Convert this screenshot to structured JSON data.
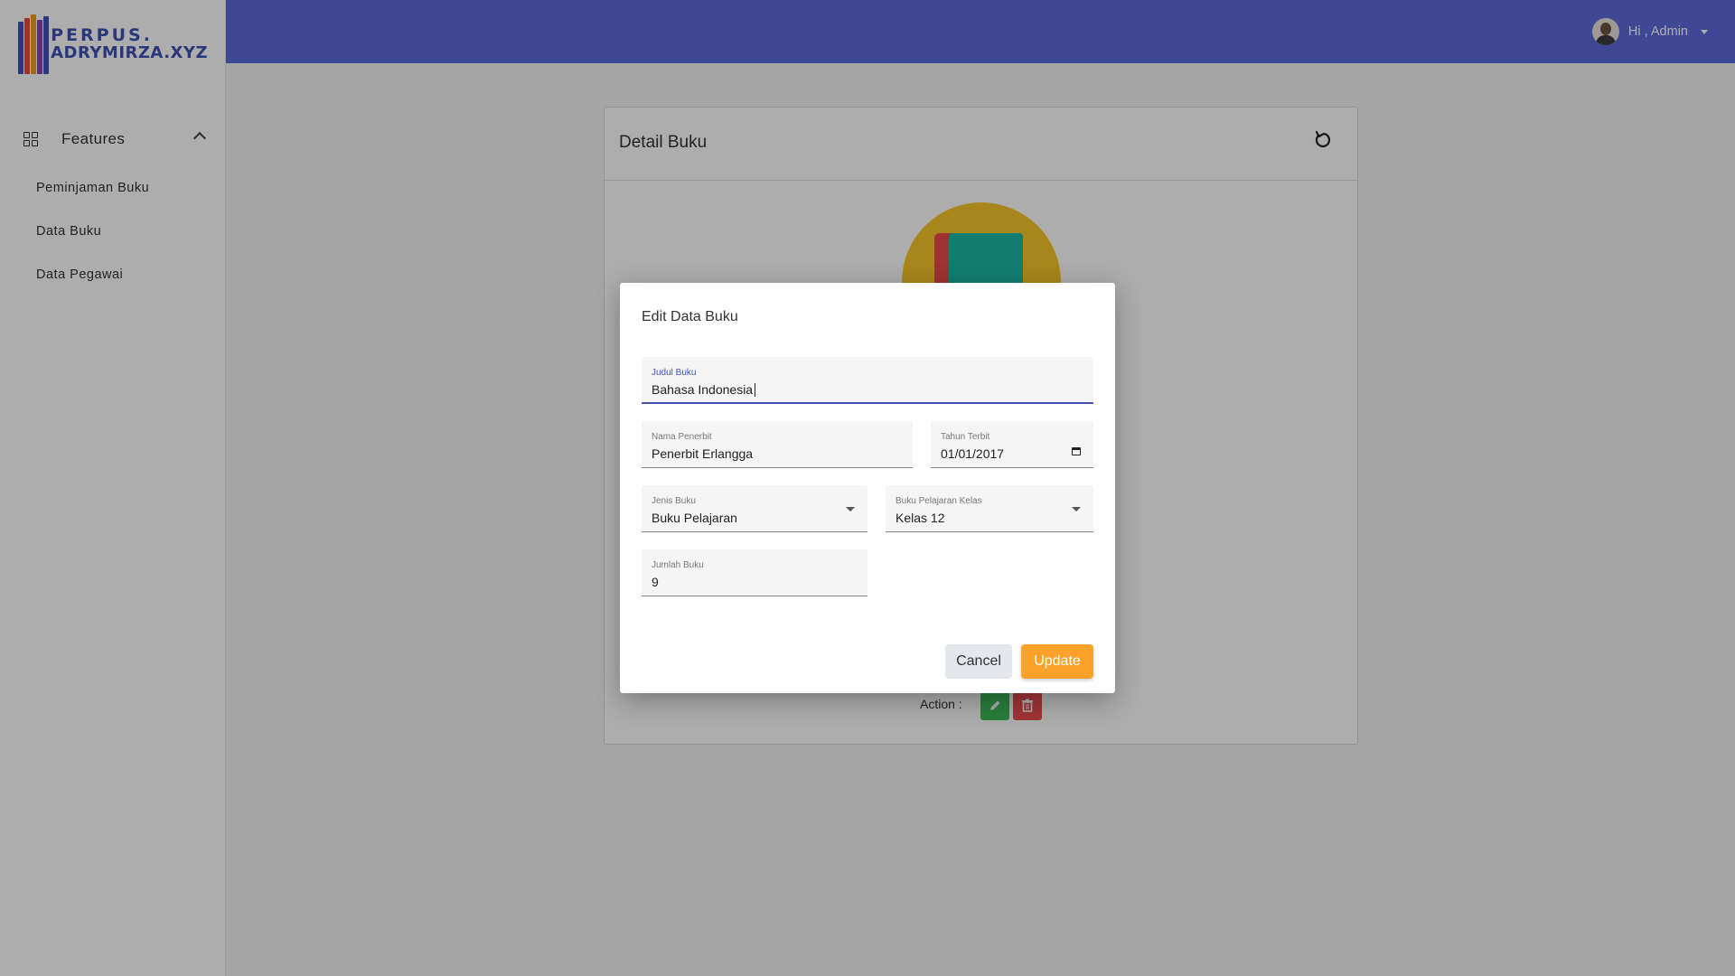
{
  "brand": {
    "line1": "PERPUS.",
    "line2": "ADRYMIRZA.XYZ"
  },
  "sidebar": {
    "section": {
      "label": "Features",
      "icon": "grid-icon",
      "expanded": true
    },
    "items": [
      {
        "label": "Peminjaman Buku"
      },
      {
        "label": "Data Buku"
      },
      {
        "label": "Data Pegawai"
      }
    ]
  },
  "header": {
    "greeting": "Hi , Admin",
    "accent_color": "#5c6bdc"
  },
  "detail_card": {
    "title": "Detail Buku",
    "action_label": "Action :"
  },
  "modal": {
    "title": "Edit Data Buku",
    "fields": {
      "judul_buku": {
        "label": "Judul Buku",
        "value": "Bahasa Indonesia"
      },
      "nama_penerbit": {
        "label": "Nama Penerbit",
        "value": "Penerbit Erlangga"
      },
      "tahun_terbit": {
        "label": "Tahun Terbit",
        "value": "01/01/2017"
      },
      "jenis_buku": {
        "label": "Jenis Buku",
        "value": "Buku Pelajaran"
      },
      "kelas": {
        "label": "Buku Pelajaran Kelas",
        "value": "Kelas 12"
      },
      "jumlah_buku": {
        "label": "Jumlah Buku",
        "value": "9"
      }
    },
    "cancel_label": "Cancel",
    "update_label": "Update",
    "update_color": "#fca22b"
  }
}
